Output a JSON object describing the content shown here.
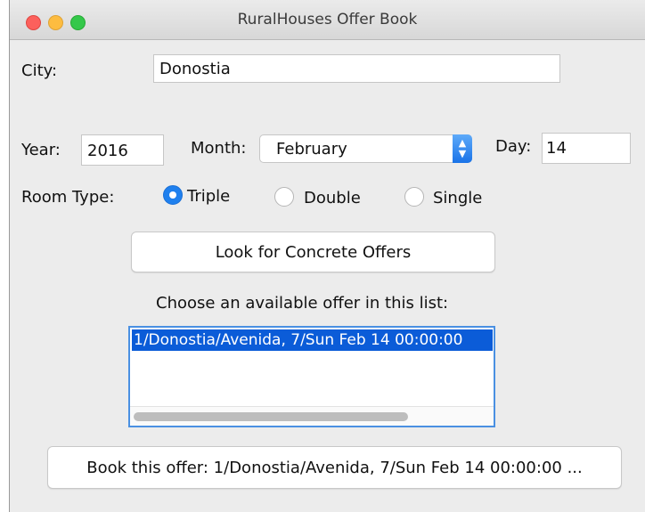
{
  "window": {
    "title": "RuralHouses Offer Book"
  },
  "city": {
    "label": "City:",
    "value": "Donostia"
  },
  "date": {
    "year_label": "Year:",
    "year_value": "2016",
    "month_label": "Month:",
    "month_value": "February",
    "day_label": "Day:",
    "day_value": "14"
  },
  "room_type": {
    "label": "Room Type:",
    "options": [
      {
        "label": "Triple",
        "selected": true
      },
      {
        "label": "Double",
        "selected": false
      },
      {
        "label": "Single",
        "selected": false
      }
    ]
  },
  "search_button": {
    "label": "Look for Concrete Offers"
  },
  "offers": {
    "prompt": "Choose an available offer in this list:",
    "items": [
      "1/Donostia/Avenida, 7/Sun Feb 14 00:00:00"
    ]
  },
  "book_button": {
    "label": "Book this offer: 1/Donostia/Avenida, 7/Sun Feb 14 00:00:00 ..."
  },
  "colors": {
    "accent": "#1f80ee",
    "selection": "#0b5cd8",
    "focus_border": "#4a90e2"
  }
}
